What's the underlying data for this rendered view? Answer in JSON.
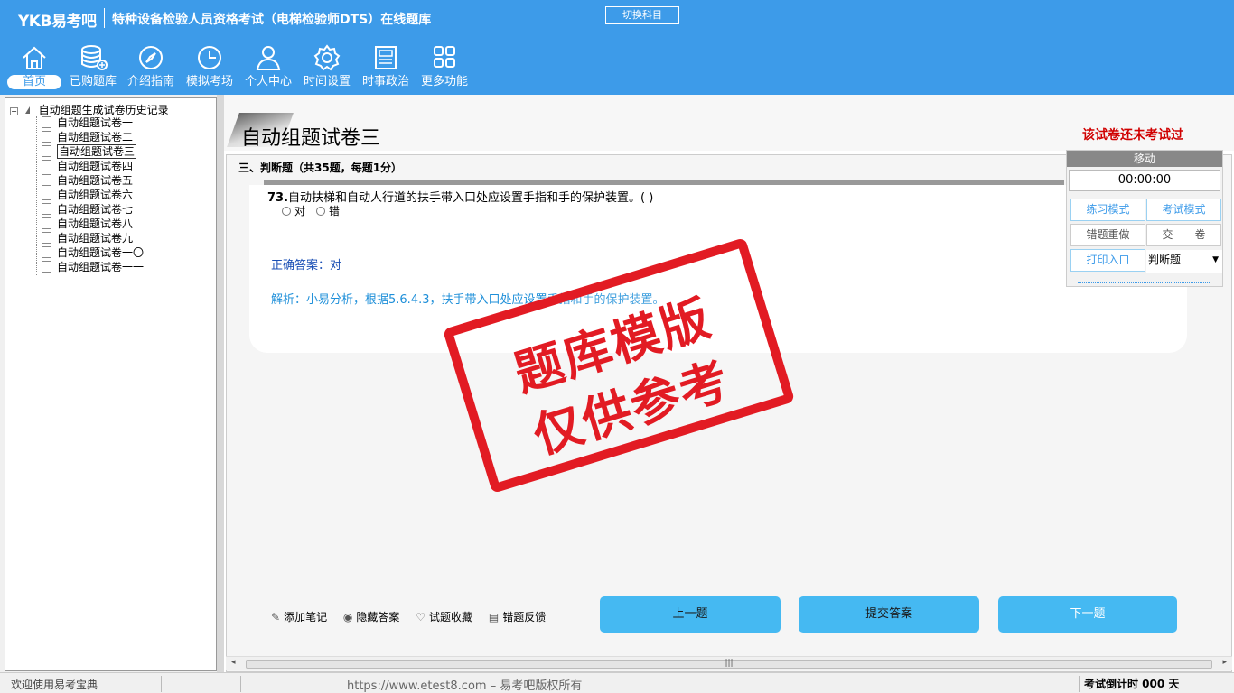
{
  "header": {
    "logo": "YKB易考吧",
    "title": "特种设备检验人员资格考试（电梯检验师DTS）在线题库",
    "switch_subject": "切换科目"
  },
  "nav": [
    {
      "label": "首页",
      "icon": "home-icon"
    },
    {
      "label": "已购题库",
      "icon": "database-icon"
    },
    {
      "label": "介绍指南",
      "icon": "compass-icon"
    },
    {
      "label": "模拟考场",
      "icon": "clock-icon"
    },
    {
      "label": "个人中心",
      "icon": "user-icon"
    },
    {
      "label": "时间设置",
      "icon": "gear-icon"
    },
    {
      "label": "时事政治",
      "icon": "newspaper-icon"
    },
    {
      "label": "更多功能",
      "icon": "grid-icon"
    }
  ],
  "tree": {
    "root": "自动组题生成试卷历史记录",
    "items": [
      "自动组题试卷一",
      "自动组题试卷二",
      "自动组题试卷三",
      "自动组题试卷四",
      "自动组题试卷五",
      "自动组题试卷六",
      "自动组题试卷七",
      "自动组题试卷八",
      "自动组题试卷九",
      "自动组题试卷一〇",
      "自动组题试卷一一"
    ],
    "selected_index": 2
  },
  "paper": {
    "title": "自动组题试卷三",
    "status": "该试卷还未考试过"
  },
  "question": {
    "section": "三、判断题（共35题，每题1分）",
    "number": "73.",
    "text": "自动扶梯和自动人行道的扶手带入口处应设置手指和手的保护装置。( )",
    "options": [
      "对",
      "错"
    ],
    "answer": "正确答案：对",
    "analysis": "解析：小易分析，根据5.6.4.3，扶手带入口处应设置手指和手的保护装置。"
  },
  "stamp": {
    "line1": "题库模版",
    "line2": "仅供参考"
  },
  "tools": [
    "添加笔记",
    "隐藏答案",
    "试题收藏",
    "错题反馈"
  ],
  "buttons": {
    "prev": "上一题",
    "submit": "提交答案",
    "next": "下一题"
  },
  "right_panel": {
    "move": "移动",
    "timer": "00:00:00",
    "practice_mode": "练习模式",
    "exam_mode": "考试模式",
    "redo_wrong": "错题重做",
    "hand_in": "交　　卷",
    "print": "打印入口",
    "type_select": "判断题"
  },
  "status": {
    "welcome": "欢迎使用易考宝典",
    "site": "https://www.etest8.com – 易考吧版权所有",
    "countdown": "考试倒计时 000 天"
  }
}
